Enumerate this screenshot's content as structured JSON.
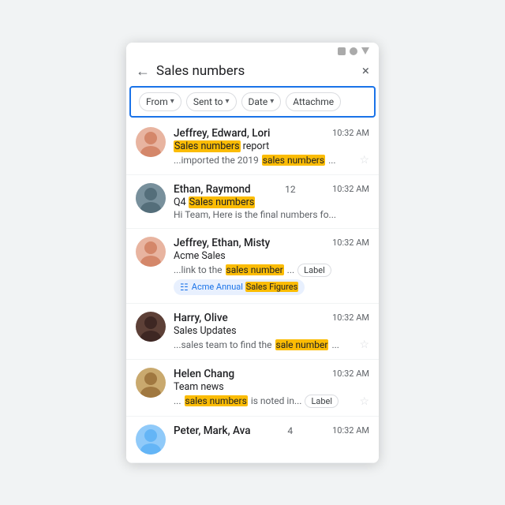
{
  "statusBar": {
    "icons": [
      "square",
      "circle",
      "triangle"
    ]
  },
  "searchBar": {
    "backArrow": "←",
    "query": "Sales numbers",
    "closeBtn": "×"
  },
  "filterBar": {
    "filters": [
      {
        "label": "From",
        "arrow": "▾"
      },
      {
        "label": "Sent to",
        "arrow": "▾"
      },
      {
        "label": "Date",
        "arrow": "▾"
      },
      {
        "label": "Attachme",
        "arrow": ""
      }
    ]
  },
  "emails": [
    {
      "id": 1,
      "avatarColor": "#e8b4a0",
      "avatarEmoji": "👩",
      "senderName": "Jeffrey, Edward, Lori",
      "time": "10:32 AM",
      "subjectParts": [
        {
          "text": "Sales numbers",
          "highlight": true
        },
        {
          "text": " report",
          "highlight": false
        }
      ],
      "previewParts": [
        {
          "text": "...imported the 2019 ",
          "highlight": false
        },
        {
          "text": "sales numbers",
          "highlight": true
        },
        {
          "text": "...",
          "highlight": false
        }
      ],
      "showStar": true,
      "label": "",
      "attachment": ""
    },
    {
      "id": 2,
      "avatarColor": "#b0bec5",
      "avatarEmoji": "👨",
      "senderName": "Ethan, Raymond",
      "unreadCount": "12",
      "time": "10:32 AM",
      "subjectParts": [
        {
          "text": "Q4 ",
          "highlight": false
        },
        {
          "text": "Sales numbers",
          "highlight": true
        }
      ],
      "previewParts": [
        {
          "text": "Hi Team, Here is the final numbers fo...",
          "highlight": false
        }
      ],
      "showStar": false,
      "label": "",
      "attachment": ""
    },
    {
      "id": 3,
      "avatarColor": "#e8b4a0",
      "avatarEmoji": "👩",
      "senderName": "Jeffrey, Ethan, Misty",
      "time": "10:32 AM",
      "subjectParts": [
        {
          "text": "Acme Sales",
          "highlight": false
        }
      ],
      "previewParts": [
        {
          "text": "...link to the ",
          "highlight": false
        },
        {
          "text": "sales number",
          "highlight": true
        },
        {
          "text": "...",
          "highlight": false
        }
      ],
      "showStar": false,
      "label": "Label",
      "attachment": "Acme Annual Sales Figures"
    },
    {
      "id": 4,
      "avatarColor": "#5d4037",
      "avatarEmoji": "👦",
      "senderName": "Harry, Olive",
      "time": "10:32 AM",
      "subjectParts": [
        {
          "text": "Sales Updates",
          "highlight": false
        }
      ],
      "previewParts": [
        {
          "text": "...sales team to find the ",
          "highlight": false
        },
        {
          "text": "sale number",
          "highlight": true
        },
        {
          "text": "...",
          "highlight": false
        }
      ],
      "showStar": true,
      "label": "",
      "attachment": ""
    },
    {
      "id": 5,
      "avatarColor": "#c9a96e",
      "avatarEmoji": "👩",
      "senderName": "Helen Chang",
      "time": "10:32 AM",
      "subjectParts": [
        {
          "text": "Team news",
          "highlight": false
        }
      ],
      "previewParts": [
        {
          "text": "...",
          "highlight": false
        },
        {
          "text": "sales numbers",
          "highlight": true
        },
        {
          "text": " is noted in...",
          "highlight": false
        }
      ],
      "showStar": true,
      "label": "Label",
      "attachment": ""
    },
    {
      "id": 6,
      "avatarColor": "#90caf9",
      "avatarEmoji": "👩",
      "senderName": "Peter, Mark, Ava",
      "unreadCount": "4",
      "time": "10:32 AM",
      "subjectParts": [],
      "previewParts": [],
      "showStar": false,
      "label": "",
      "attachment": ""
    }
  ]
}
